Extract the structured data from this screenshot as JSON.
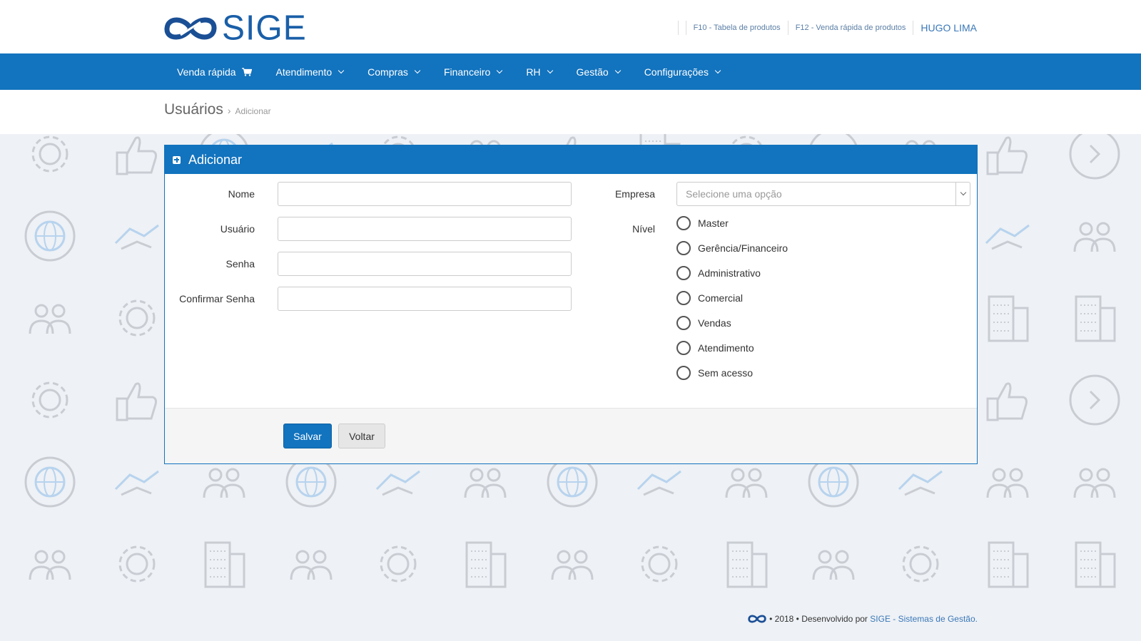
{
  "brand": {
    "name": "SIGE"
  },
  "toplinks": [
    {
      "label": "F10 - Tabela de produtos"
    },
    {
      "label": "F12 - Venda rápida de produtos"
    }
  ],
  "user": {
    "name": "HUGO LIMA"
  },
  "nav": [
    {
      "label": "Venda rápida",
      "icon": "cart-icon"
    },
    {
      "label": "Atendimento"
    },
    {
      "label": "Compras"
    },
    {
      "label": "Financeiro"
    },
    {
      "label": "RH"
    },
    {
      "label": "Gestão"
    },
    {
      "label": "Configurações"
    }
  ],
  "breadcrumb": {
    "title": "Usuários",
    "current": "Adicionar"
  },
  "panel": {
    "title": "Adicionar",
    "fields": [
      {
        "label": "Nome",
        "value": ""
      },
      {
        "label": "Usuário",
        "value": ""
      },
      {
        "label": "Senha",
        "value": ""
      },
      {
        "label": "Confirmar Senha",
        "value": ""
      }
    ],
    "empresa": {
      "label": "Empresa",
      "placeholder": "Selecione uma opção"
    },
    "nivel": {
      "label": "Nível",
      "options": [
        "Master",
        "Gerência/Financeiro",
        "Administrativo",
        "Comercial",
        "Vendas",
        "Atendimento",
        "Sem acesso"
      ],
      "selected": null
    },
    "buttons": {
      "save": "Salvar",
      "back": "Voltar"
    }
  },
  "footer": {
    "text": "• 2018 • Desenvolvido por ",
    "link": "SIGE - Sistemas de Gestão."
  },
  "colors": {
    "primary": "#1273be",
    "background": "#eef1f5",
    "icon_gray": "#c9cdd3",
    "icon_blue": "#b7d3ee"
  }
}
